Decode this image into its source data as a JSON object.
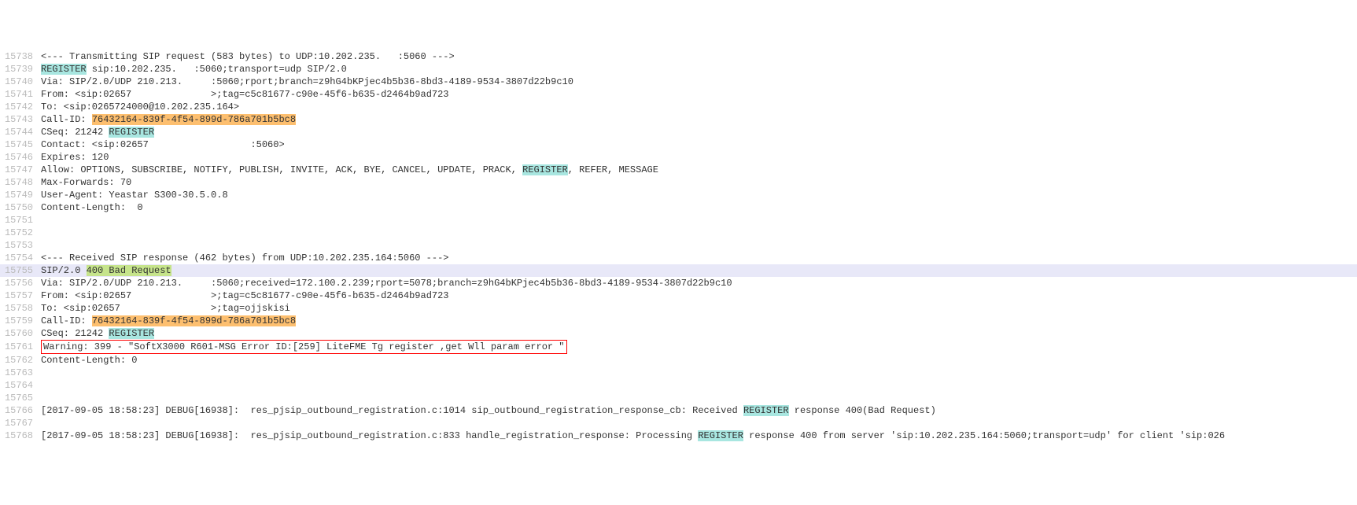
{
  "lines": [
    {
      "ln": 15738,
      "segs": [
        {
          "t": "<--- Transmitting SIP request (583 bytes) to UDP:10.202.235."
        },
        {
          "t": "   ",
          "cls": "blur"
        },
        {
          "t": ":5060 --->"
        }
      ]
    },
    {
      "ln": 15739,
      "segs": [
        {
          "t": "REGISTER",
          "cls": "hl-cyan"
        },
        {
          "t": " sip:10.202.235."
        },
        {
          "t": "   ",
          "cls": "blur"
        },
        {
          "t": ":5060;transport=udp SIP/2.0"
        }
      ]
    },
    {
      "ln": 15740,
      "segs": [
        {
          "t": "Via: SIP/2.0/UDP 210.213."
        },
        {
          "t": "     ",
          "cls": "blur"
        },
        {
          "t": ":5060;rport;branch=z9hG4bKPjec4b5b36-8bd3-4189-9534-3807d22b9c10"
        }
      ]
    },
    {
      "ln": 15741,
      "segs": [
        {
          "t": "From: <sip:02657"
        },
        {
          "t": "              ",
          "cls": "blur"
        },
        {
          "t": ">;tag=c5c81677-c90e-45f6-b635-d2464b9ad723"
        }
      ]
    },
    {
      "ln": 15742,
      "segs": [
        {
          "t": "To: <sip:0265724000@10.202.235.164>"
        }
      ]
    },
    {
      "ln": 15743,
      "segs": [
        {
          "t": "Call-ID: "
        },
        {
          "t": "76432164-839f-4f54-899d-786a701b5bc8",
          "cls": "hl-orange"
        }
      ]
    },
    {
      "ln": 15744,
      "segs": [
        {
          "t": "CSeq: 21242 "
        },
        {
          "t": "REGISTER",
          "cls": "hl-cyan"
        }
      ]
    },
    {
      "ln": 15745,
      "segs": [
        {
          "t": "Contact: <sip:02657"
        },
        {
          "t": "                  ",
          "cls": "blur"
        },
        {
          "t": ":5060>"
        }
      ]
    },
    {
      "ln": 15746,
      "segs": [
        {
          "t": "Expires: 120"
        }
      ]
    },
    {
      "ln": 15747,
      "segs": [
        {
          "t": "Allow: OPTIONS, SUBSCRIBE, NOTIFY, PUBLISH, INVITE, ACK, BYE, CANCEL, UPDATE, PRACK, "
        },
        {
          "t": "REGISTER",
          "cls": "hl-cyan"
        },
        {
          "t": ", REFER, MESSAGE"
        }
      ]
    },
    {
      "ln": 15748,
      "segs": [
        {
          "t": "Max-Forwards: 70"
        }
      ]
    },
    {
      "ln": 15749,
      "segs": [
        {
          "t": "User-Agent: Yeastar S300-30.5.0.8"
        }
      ]
    },
    {
      "ln": 15750,
      "segs": [
        {
          "t": "Content-Length:  0"
        }
      ]
    },
    {
      "ln": 15751,
      "segs": [
        {
          "t": ""
        }
      ]
    },
    {
      "ln": 15752,
      "segs": [
        {
          "t": ""
        }
      ]
    },
    {
      "ln": 15753,
      "segs": [
        {
          "t": ""
        }
      ]
    },
    {
      "ln": 15754,
      "segs": [
        {
          "t": "<--- Received SIP response (462 bytes) from UDP:10.202.235.164:5060 --->"
        }
      ]
    },
    {
      "ln": 15755,
      "sel": true,
      "segs": [
        {
          "t": "SIP/2.0 "
        },
        {
          "t": "400 Bad Request",
          "cls": "hl-green"
        }
      ]
    },
    {
      "ln": 15756,
      "segs": [
        {
          "t": "Via: SIP/2.0/UDP 210.213."
        },
        {
          "t": "     ",
          "cls": "blur"
        },
        {
          "t": ":5060;received=172.100.2.239;rport=5078;branch=z9hG4bKPjec4b5b36-8bd3-4189-9534-3807d22b9c10"
        }
      ]
    },
    {
      "ln": 15757,
      "segs": [
        {
          "t": "From: <sip:02657"
        },
        {
          "t": "              ",
          "cls": "blur"
        },
        {
          "t": ">;tag=c5c81677-c90e-45f6-b635-d2464b9ad723"
        }
      ]
    },
    {
      "ln": 15758,
      "segs": [
        {
          "t": "To: <sip:02657"
        },
        {
          "t": "                ",
          "cls": "blur"
        },
        {
          "t": ">;tag=ojjskisi"
        }
      ]
    },
    {
      "ln": 15759,
      "segs": [
        {
          "t": "Call-ID: "
        },
        {
          "t": "76432164-839f-4f54-899d-786a701b5bc8",
          "cls": "hl-orange"
        }
      ]
    },
    {
      "ln": 15760,
      "segs": [
        {
          "t": "CSeq: 21242 "
        },
        {
          "t": "REGISTER",
          "cls": "hl-cyan"
        }
      ]
    },
    {
      "ln": 15761,
      "segs": [
        {
          "t": "Warning: 399 - \"SoftX3000 R601-MSG Error ID:[259] LiteFME Tg register ,get Wll param error \"",
          "cls": "boxed"
        }
      ]
    },
    {
      "ln": 15762,
      "segs": [
        {
          "t": "Content-Length: 0"
        }
      ]
    },
    {
      "ln": 15763,
      "segs": [
        {
          "t": ""
        }
      ]
    },
    {
      "ln": 15764,
      "segs": [
        {
          "t": ""
        }
      ]
    },
    {
      "ln": 15765,
      "segs": [
        {
          "t": ""
        }
      ]
    },
    {
      "ln": 15766,
      "segs": [
        {
          "t": "[2017-09-05 18:58:23] DEBUG[16938]:  res_pjsip_outbound_registration.c:1014 sip_outbound_registration_response_cb: Received "
        },
        {
          "t": "REGISTER",
          "cls": "hl-cyan"
        },
        {
          "t": " response 400(Bad Request)"
        }
      ]
    },
    {
      "ln": 15767,
      "segs": [
        {
          "t": ""
        }
      ]
    },
    {
      "ln": 15768,
      "segs": [
        {
          "t": "[2017-09-05 18:58:23] DEBUG[16938]:  res_pjsip_outbound_registration.c:833 handle_registration_response: Processing "
        },
        {
          "t": "REGISTER",
          "cls": "hl-cyan"
        },
        {
          "t": " response 400 from server 'sip:10.202.235.164:5060;transport=udp' for client 'sip:026"
        }
      ]
    }
  ]
}
